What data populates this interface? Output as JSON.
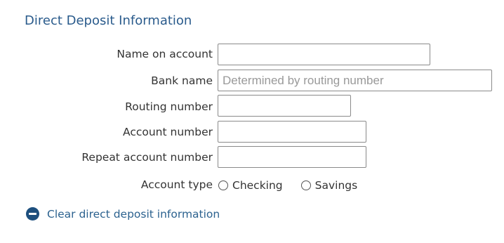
{
  "section": {
    "title": "Direct Deposit Information"
  },
  "fields": {
    "name_on_account": {
      "label": "Name on account",
      "value": "",
      "placeholder": ""
    },
    "bank_name": {
      "label": "Bank name",
      "value": "",
      "placeholder": "Determined by routing number"
    },
    "routing_number": {
      "label": "Routing number",
      "value": "",
      "placeholder": ""
    },
    "account_number": {
      "label": "Account number",
      "value": "",
      "placeholder": ""
    },
    "repeat_account_number": {
      "label": "Repeat account number",
      "value": "",
      "placeholder": ""
    }
  },
  "account_type": {
    "label": "Account type",
    "options": [
      {
        "label": "Checking",
        "selected": false
      },
      {
        "label": "Savings",
        "selected": false
      }
    ]
  },
  "clear_link": {
    "label": "Clear direct deposit information",
    "icon": "minus-circle-icon"
  },
  "colors": {
    "title": "#2a5b8c",
    "link": "#2c628f",
    "icon_fill": "#1d4f7e",
    "input_border": "#8a8a8a",
    "placeholder": "#999999"
  }
}
